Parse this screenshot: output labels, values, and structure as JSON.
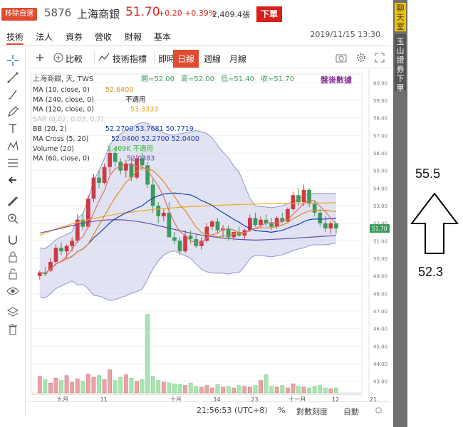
{
  "header": {
    "remove_label": "移除自選",
    "code": "5876",
    "name": "上海商銀",
    "price": "51.70",
    "change": "+0.20 +0.39%",
    "volume": "2,409.4張",
    "order_label": "下單",
    "datetime": "2019/11/15 13:30"
  },
  "tabs": [
    "技術",
    "法人",
    "資券",
    "營收",
    "財報",
    "基本"
  ],
  "toolbar": {
    "compare": "比較",
    "indicators": "技術指標",
    "realtime": "即時",
    "daily": "日線",
    "weekly": "週線",
    "monthly": "月線"
  },
  "side": {
    "chat": "聊天室",
    "order": "玉山證券下單"
  },
  "annotations": {
    "high": "55.5",
    "low": "52.3"
  },
  "status": {
    "time": "21:56:53 (UTC+8)",
    "percent": "%",
    "log": "對數刻度",
    "auto": "自動"
  },
  "colors": {
    "up": "#e0261b",
    "up_candle": "#cc3b45",
    "down_candle": "#3d9a5b",
    "band": "#c8cce8"
  },
  "chart_data": {
    "type": "candlestick",
    "title": "上海商銀, 天, TWS",
    "watermark": "盤後數據",
    "ohlc_label": {
      "open": "開=52.00",
      "high": "高=52.00",
      "low": "低=51.40",
      "close": "收=51.70"
    },
    "legend": [
      {
        "name": "MA (10, close, 0)",
        "value": "52.6400",
        "color": "#e28a1a"
      },
      {
        "name": "MA (240, close, 0)",
        "value": "不適用",
        "color": "#222222"
      },
      {
        "name": "MA (120, close, 0)",
        "value": "53.3333",
        "color": "#f0a020"
      },
      {
        "name": "SAR (0.02, 0.02, 0.2)",
        "value": "",
        "color": "#bbbbbb"
      },
      {
        "name": "BB (20, 2)",
        "value": "52.2700  53.7681  50.7719",
        "color": "#1a3fb8"
      },
      {
        "name": "MA Cross (5, 20)",
        "value": "52.0400  52.2700  52.0400",
        "color": "#1a3fb8"
      },
      {
        "name": "Volume (20)",
        "value": "2.409K  不適用",
        "color": "#2bbf2b"
      },
      {
        "name": "MA (60, close, 0)",
        "value": "52.0383",
        "color": "#6a4fa6"
      }
    ],
    "ylim": [
      42.5,
      60.5
    ],
    "yticks": [
      "60.00",
      "59.00",
      "58.00",
      "57.00",
      "56.00",
      "55.00",
      "54.00",
      "53.00",
      "52.00",
      "51.00",
      "50.00",
      "49.00",
      "48.00",
      "47.00",
      "46.00",
      "45.00",
      "44.00",
      "43.00"
    ],
    "last_price_label": "51.70",
    "xticks": [
      {
        "label": "九月",
        "bar": 4
      },
      {
        "label": "11",
        "bar": 12
      },
      {
        "label": "十月",
        "bar": 25
      },
      {
        "label": "14",
        "bar": 33
      },
      {
        "label": "23",
        "bar": 40
      },
      {
        "label": "十一月",
        "bar": 47
      },
      {
        "label": "12",
        "bar": 55
      },
      {
        "label": "21",
        "bar": 62
      }
    ],
    "candles": [
      [
        49.0,
        49.3,
        48.8,
        49.2
      ],
      [
        49.2,
        49.5,
        49.0,
        49.1
      ],
      [
        49.3,
        50.0,
        49.2,
        49.8
      ],
      [
        49.8,
        50.8,
        49.6,
        50.6
      ],
      [
        50.6,
        50.9,
        50.2,
        50.4
      ],
      [
        50.4,
        50.8,
        50.0,
        50.7
      ],
      [
        50.7,
        51.2,
        50.4,
        51.0
      ],
      [
        51.0,
        52.5,
        50.9,
        52.2
      ],
      [
        52.2,
        52.6,
        51.6,
        51.8
      ],
      [
        51.8,
        53.6,
        51.7,
        53.4
      ],
      [
        53.4,
        54.8,
        53.2,
        54.6
      ],
      [
        54.6,
        55.0,
        54.0,
        54.3
      ],
      [
        54.3,
        55.4,
        54.2,
        55.2
      ],
      [
        55.2,
        56.2,
        54.8,
        56.0
      ],
      [
        56.0,
        56.3,
        55.2,
        55.5
      ],
      [
        55.5,
        55.7,
        54.8,
        55.0
      ],
      [
        55.0,
        55.6,
        54.6,
        55.4
      ],
      [
        55.4,
        55.8,
        54.4,
        54.6
      ],
      [
        54.6,
        55.9,
        54.5,
        55.7
      ],
      [
        55.7,
        56.0,
        55.0,
        55.3
      ],
      [
        55.3,
        55.5,
        54.0,
        54.2
      ],
      [
        54.2,
        54.5,
        52.6,
        53.0
      ],
      [
        53.0,
        53.2,
        52.0,
        52.4
      ],
      [
        52.4,
        52.8,
        52.1,
        52.6
      ],
      [
        52.6,
        53.2,
        52.0,
        51.2
      ],
      [
        51.2,
        51.5,
        50.8,
        51.0
      ],
      [
        51.0,
        51.2,
        50.2,
        50.4
      ],
      [
        50.4,
        51.6,
        50.3,
        51.3
      ],
      [
        51.3,
        51.6,
        50.8,
        51.1
      ],
      [
        51.1,
        51.4,
        50.6,
        50.7
      ],
      [
        50.7,
        51.2,
        50.5,
        51.0
      ],
      [
        51.0,
        52.0,
        50.9,
        51.8
      ],
      [
        51.8,
        52.2,
        51.6,
        52.1
      ],
      [
        52.1,
        52.3,
        51.4,
        51.6
      ],
      [
        51.6,
        51.9,
        51.2,
        51.7
      ],
      [
        51.7,
        51.9,
        51.0,
        51.2
      ],
      [
        51.2,
        51.6,
        51.0,
        51.5
      ],
      [
        51.5,
        51.8,
        51.2,
        51.3
      ],
      [
        51.3,
        51.7,
        51.1,
        51.6
      ],
      [
        51.6,
        52.5,
        51.5,
        52.3
      ],
      [
        52.3,
        52.6,
        51.8,
        51.9
      ],
      [
        51.9,
        52.4,
        51.7,
        52.2
      ],
      [
        52.2,
        52.5,
        51.8,
        52.0
      ],
      [
        52.0,
        52.3,
        51.6,
        51.8
      ],
      [
        51.8,
        52.4,
        51.7,
        52.3
      ],
      [
        52.3,
        52.6,
        52.0,
        52.1
      ],
      [
        52.1,
        52.9,
        52.0,
        52.8
      ],
      [
        52.8,
        53.8,
        52.7,
        53.6
      ],
      [
        53.6,
        54.0,
        53.0,
        53.2
      ],
      [
        53.2,
        54.2,
        53.0,
        53.9
      ],
      [
        53.9,
        54.0,
        52.9,
        53.1
      ],
      [
        53.1,
        53.3,
        52.4,
        52.6
      ],
      [
        52.6,
        52.8,
        51.8,
        52.0
      ],
      [
        52.0,
        52.4,
        51.5,
        51.7
      ],
      [
        51.7,
        52.1,
        51.4,
        52.0
      ],
      [
        52.0,
        52.0,
        51.4,
        51.7
      ]
    ],
    "volumes": [
      2.0,
      1.6,
      1.2,
      1.8,
      1.5,
      2.1,
      1.3,
      1.7,
      1.4,
      2.3,
      1.9,
      2.1,
      1.6,
      2.8,
      1.5,
      1.9,
      2.2,
      1.8,
      1.4,
      1.6,
      9.5,
      2.0,
      1.5,
      1.3,
      1.2,
      1.1,
      1.0,
      0.9,
      1.2,
      0.8,
      0.7,
      0.9,
      0.6,
      1.0,
      0.7,
      0.8,
      0.6,
      0.9,
      0.8,
      0.7,
      0.9,
      1.5,
      2.2,
      0.8,
      0.7,
      0.9,
      0.6,
      1.1,
      0.8,
      0.7,
      0.6,
      0.8,
      0.9,
      0.6,
      0.5,
      0.6
    ],
    "vol_max": 10
  }
}
